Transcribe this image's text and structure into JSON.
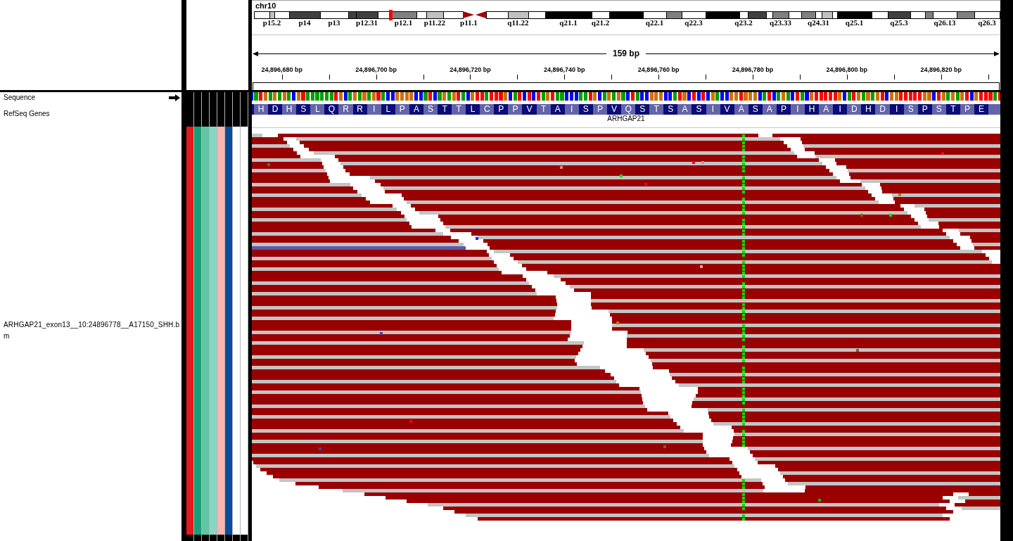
{
  "ideogram": {
    "chromosome": "chr10",
    "bands": [
      {
        "kind": "band",
        "color": "#ffffff",
        "selected": false
      },
      {
        "kind": "band",
        "label": "p15.2",
        "color": "#c0c0c0",
        "selected": false
      },
      {
        "kind": "band",
        "color": "#ffffff",
        "selected": false
      },
      {
        "kind": "band",
        "label": "p14",
        "color": "#404040",
        "selected": false
      },
      {
        "kind": "band",
        "label": "p13",
        "color": "#ffffff",
        "selected": false
      },
      {
        "kind": "band",
        "color": "#404040",
        "selected": false
      },
      {
        "kind": "band",
        "label": "p12.31",
        "color": "#404040",
        "selected": false
      },
      {
        "kind": "band",
        "color": "#ffffff",
        "selected": false
      },
      {
        "kind": "band",
        "label": "p12.1",
        "color": "#808080",
        "selected": true
      },
      {
        "kind": "band",
        "color": "#ffffff",
        "selected": false
      },
      {
        "kind": "band",
        "label": "p11.22",
        "color": "#c0c0c0",
        "selected": false
      },
      {
        "kind": "band",
        "color": "#ffffff",
        "selected": false
      },
      {
        "kind": "centromere",
        "label": "p11.1",
        "color": "#a50000",
        "selected": false
      },
      {
        "kind": "centromere",
        "color": "#a50000",
        "selected": false
      },
      {
        "kind": "band",
        "color": "#ffffff",
        "selected": false
      },
      {
        "kind": "band",
        "label": "q11.22",
        "color": "#c0c0c0",
        "selected": false
      },
      {
        "kind": "band",
        "color": "#ffffff",
        "selected": false
      },
      {
        "kind": "band",
        "label": "q21.1",
        "color": "#000000",
        "selected": false
      },
      {
        "kind": "band",
        "label": "q21.2",
        "color": "#ffffff",
        "selected": false
      },
      {
        "kind": "band",
        "color": "#000000",
        "selected": false
      },
      {
        "kind": "band",
        "label": "q22.1",
        "color": "#ffffff",
        "selected": false
      },
      {
        "kind": "band",
        "color": "#808080",
        "selected": false
      },
      {
        "kind": "band",
        "label": "q22.3",
        "color": "#ffffff",
        "selected": false
      },
      {
        "kind": "band",
        "color": "#000000",
        "selected": false
      },
      {
        "kind": "band",
        "label": "q23.2",
        "color": "#ffffff",
        "selected": false
      },
      {
        "kind": "band",
        "color": "#404040",
        "selected": false
      },
      {
        "kind": "band",
        "color": "#ffffff",
        "selected": false
      },
      {
        "kind": "band",
        "label": "q23.33",
        "color": "#808080",
        "selected": false
      },
      {
        "kind": "band",
        "color": "#ffffff",
        "selected": false
      },
      {
        "kind": "band",
        "color": "#808080",
        "selected": false
      },
      {
        "kind": "band",
        "label": "q24.31",
        "color": "#ffffff",
        "selected": false
      },
      {
        "kind": "band",
        "color": "#c0c0c0",
        "selected": false
      },
      {
        "kind": "band",
        "color": "#ffffff",
        "selected": false
      },
      {
        "kind": "band",
        "label": "q25.1",
        "color": "#000000",
        "selected": false
      },
      {
        "kind": "band",
        "color": "#ffffff",
        "selected": false
      },
      {
        "kind": "band",
        "label": "q25.3",
        "color": "#404040",
        "selected": false
      },
      {
        "kind": "band",
        "color": "#ffffff",
        "selected": false
      },
      {
        "kind": "band",
        "color": "#808080",
        "selected": false
      },
      {
        "kind": "band",
        "label": "q26.13",
        "color": "#ffffff",
        "selected": false
      },
      {
        "kind": "band",
        "color": "#808080",
        "selected": false
      },
      {
        "kind": "band",
        "label": "q26.3",
        "color": "#ffffff",
        "selected": false
      }
    ]
  },
  "ruler": {
    "span": "159 bp",
    "ticks": [
      "24,896,680 bp",
      "24,896,700 bp",
      "24,896,720 bp",
      "24,896,740 bp",
      "24,896,760 bp",
      "24,896,780 bp",
      "24,896,800 bp",
      "24,896,820 bp"
    ]
  },
  "tracks": [
    {
      "kind": "sequence",
      "name": "Sequence",
      "forward_strand": true
    },
    {
      "kind": "gene",
      "name": "RefSeq Genes",
      "gene": "ARHGAP21",
      "amino_acids": [
        "H",
        "D",
        "H",
        "S",
        "L",
        "Q",
        "R",
        "R",
        "I",
        "L",
        "P",
        "A",
        "S",
        "T",
        "T",
        "L",
        "C",
        "P",
        "P",
        "V",
        "T",
        "A",
        "I",
        "S",
        "P",
        "V",
        "Q",
        "S",
        "T",
        "S",
        "A",
        "S",
        "I",
        "V",
        "A",
        "S",
        "A",
        "P",
        "I",
        "H",
        "A",
        "I",
        "D",
        "H",
        "D",
        "I",
        "S",
        "P",
        "S",
        "T",
        "P",
        "E"
      ]
    },
    {
      "kind": "alignment",
      "name_lines": [
        "ARHGAP21_exon13__10:24896778__A17150_SHH.b",
        "m"
      ],
      "attributes": [
        {
          "color": "#e31a1c"
        },
        {
          "color": "#1b9e77"
        },
        {
          "color": "#66c2a5"
        },
        {
          "color": "#8dd3c7"
        },
        {
          "color": "#fbb4ae"
        },
        {
          "color": "#0d4a98"
        },
        {
          "color": "#ffffff"
        },
        {
          "color": "#ffffff"
        }
      ]
    }
  ]
}
